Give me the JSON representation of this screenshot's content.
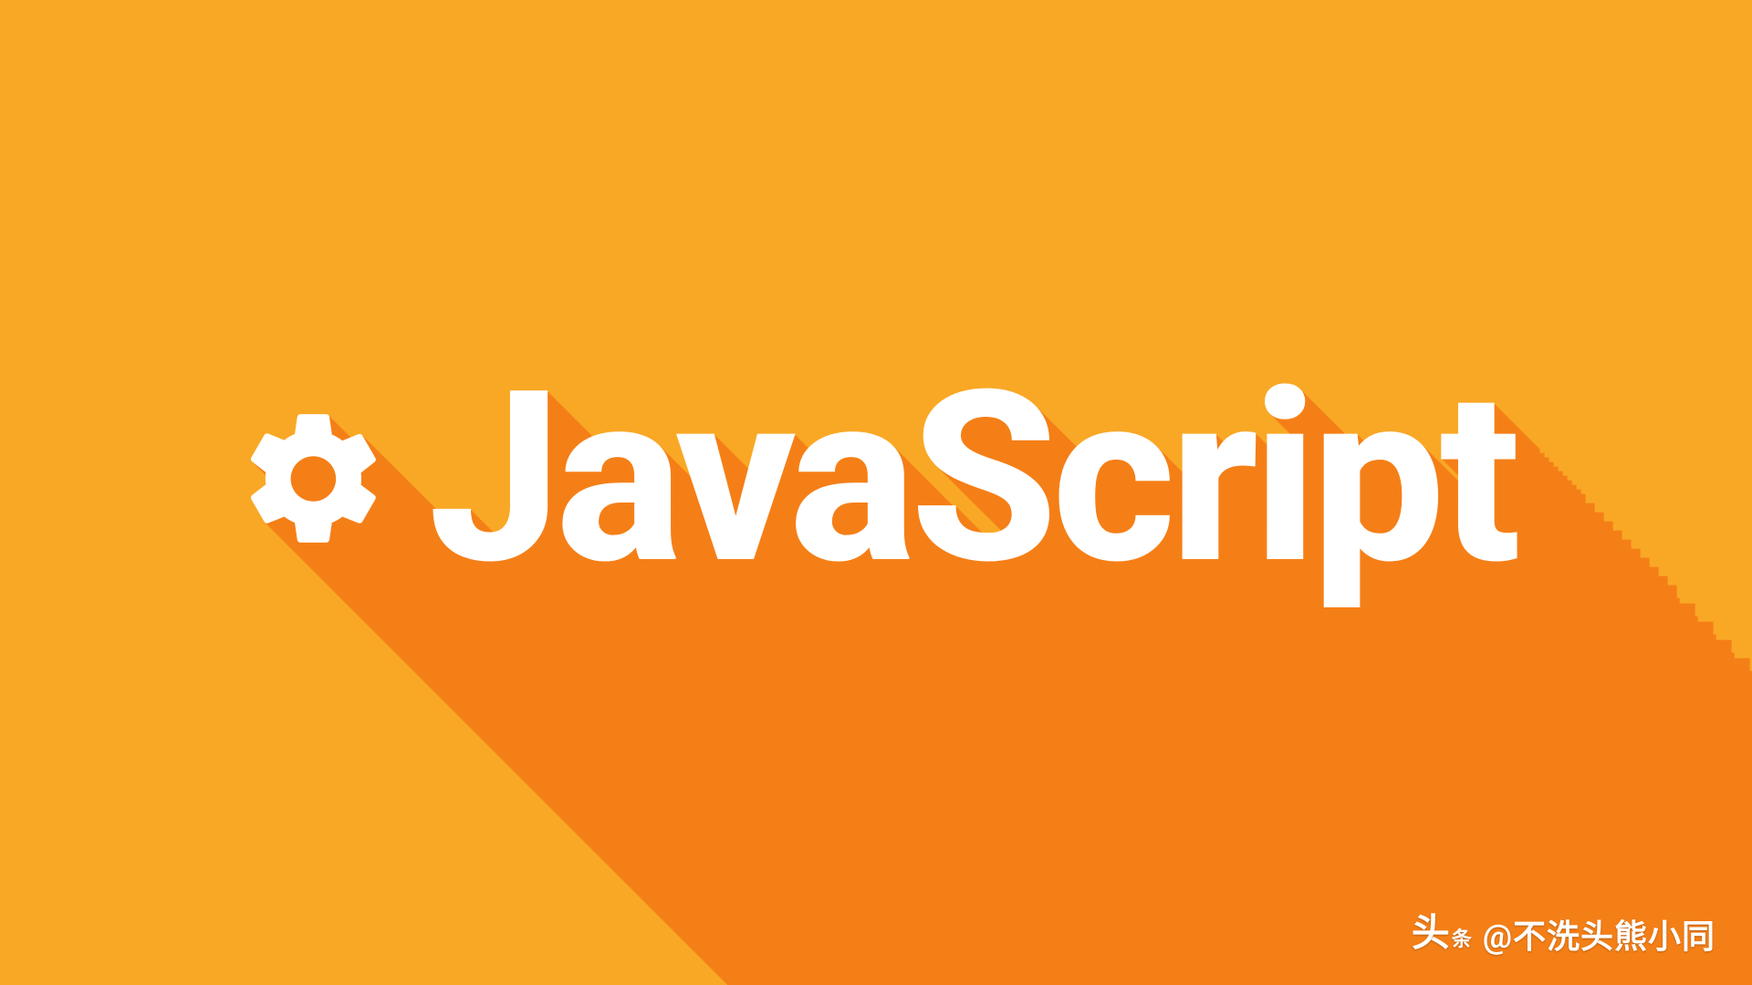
{
  "colors": {
    "background": "#f9a825",
    "shadow": "#f57f17",
    "foreground": "#ffffff"
  },
  "logo": {
    "icon_name": "gear-icon",
    "title": "JavaScript"
  },
  "watermark": {
    "badge_main": "头",
    "badge_sub": "条",
    "text": "@不洗头熊小同"
  }
}
